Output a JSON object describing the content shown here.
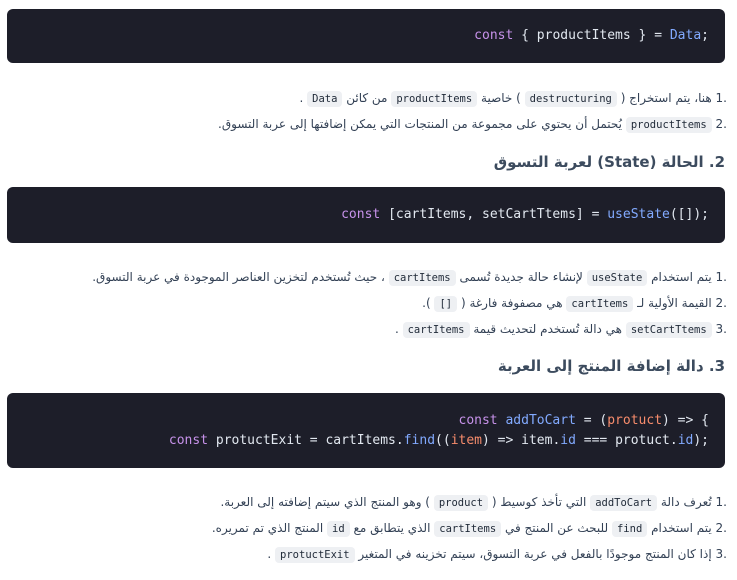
{
  "code1": {
    "kw": "const",
    "rest": " { productItems } = ",
    "data": "Data",
    "end": ";"
  },
  "list1": [
    {
      "num": ".1",
      "pre": "هنا، يتم استخراج (",
      "code1": "destructuring",
      "mid": ") خاصية",
      "code2": "productItems",
      "mid2": "من كائن",
      "code3": "Data",
      "end": "."
    },
    {
      "num": ".2",
      "code1": "productItems",
      "text": "يُحتمل أن يحتوي على مجموعة من المنتجات التي يمكن إضافتها إلى عربة التسوق."
    }
  ],
  "heading2": "2. الحالة (State) لعربة التسوق",
  "code2": {
    "kw": "const",
    "rest": " [cartItems, setCartTtems] = ",
    "fn": "useState",
    "args": "([]);"
  },
  "list2": [
    {
      "num": ".1",
      "pre": "يتم استخدام",
      "code1": "useState",
      "mid": "لإنشاء حالة جديدة تُسمى",
      "code2": "cartItems",
      "end": "، حيث تُستخدم لتخزين العناصر الموجودة في عربة التسوق."
    },
    {
      "num": ".2",
      "pre": "القيمة الأولية لـ",
      "code1": "cartItems",
      "mid": "هي مصفوفة فارغة (",
      "code2": "[]",
      "end": ")."
    },
    {
      "num": ".3",
      "code1": "setCartTtems",
      "mid": "هي دالة تُستخدم لتحديث قيمة",
      "code2": "cartItems",
      "end": "."
    }
  ],
  "heading3": "3. دالة إضافة المنتج إلى العربة",
  "code3": {
    "l1_kw": "const",
    "l1_fn": "addToCart",
    "l1_mid": " = (",
    "l1_param": "protuct",
    "l1_end": ") => {",
    "l2_kw": "const",
    "l2_a": " protuctExit = cartItems.",
    "l2_fn": "find",
    "l2_b": "((",
    "l2_param": "item",
    "l2_c": ") => item.",
    "l2_id1": "id",
    "l2_d": " === protuct.",
    "l2_id2": "id",
    "l2_e": ");"
  },
  "list3": [
    {
      "num": ".1",
      "pre": "تُعرف دالة",
      "code1": "addToCart",
      "mid": "التي تأخذ كوسيط (",
      "code2": "product",
      "end": ") وهو المنتج الذي سيتم إضافته إلى العربة."
    },
    {
      "num": ".2",
      "pre": "يتم استخدام",
      "code1": "find",
      "mid": "للبحث عن المنتج في",
      "code2": "cartItems",
      "mid2": "الذي يتطابق مع",
      "code3": "id",
      "end": "المنتج الذي تم تمريره."
    },
    {
      "num": ".3",
      "pre": "إذا كان المنتج موجودًا بالفعل في عربة التسوق، سيتم تخزينه في المتغير",
      "code1": "protuctExit",
      "end": "."
    }
  ]
}
